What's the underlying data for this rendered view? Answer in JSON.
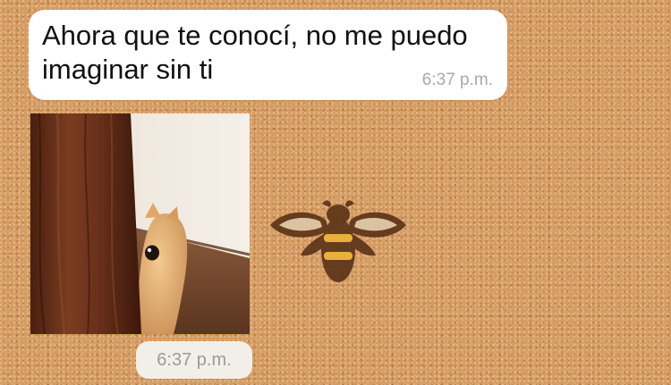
{
  "messages": [
    {
      "type": "text",
      "text": "Ahora que te conocí, no me puedo imaginar sin ti",
      "time": "6:37 p.m."
    },
    {
      "type": "image",
      "image_description_icon": "cat-peeking-photo",
      "time": "6:37 p.m."
    }
  ],
  "wallpaper": {
    "base_color": "#d59c63",
    "motif_icon": "bee-icon"
  }
}
